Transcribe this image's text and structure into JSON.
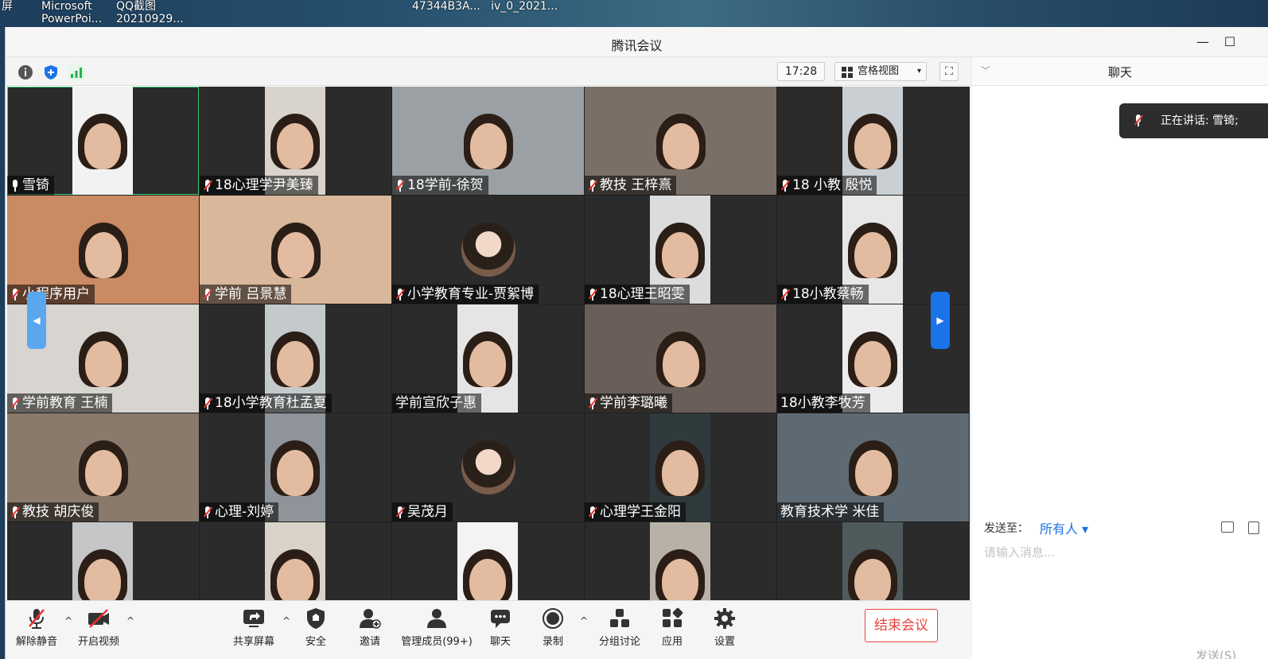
{
  "desktop": {
    "labels": [
      {
        "text": "屏"
      },
      {
        "text": "Microsoft\nPowerPoi..."
      },
      {
        "text": "QQ截图\n20210929..."
      },
      {
        "text": "47344B3A...   iv_0_2021..."
      }
    ]
  },
  "window": {
    "title": "腾讯会议",
    "minimize": "—",
    "maximize": "☐"
  },
  "toolbar": {
    "time": "17:28",
    "view_mode": "宫格视图",
    "caret": "▾",
    "fullscreen": "⛶"
  },
  "participants": [
    {
      "name": "雪锜",
      "muted": false,
      "active": true
    },
    {
      "name": "18心理学尹美臻",
      "muted": true
    },
    {
      "name": "18学前-徐贺",
      "muted": true
    },
    {
      "name": "教技 王梓熹",
      "muted": true
    },
    {
      "name": "18 小教 殷悦",
      "muted": true
    },
    {
      "name": "小程序用户",
      "muted": true
    },
    {
      "name": "学前 吕景慧",
      "muted": true
    },
    {
      "name": "小学教育专业-贾絮博",
      "muted": true
    },
    {
      "name": "18心理王昭雯",
      "muted": true
    },
    {
      "name": "18小教蔡畅",
      "muted": true
    },
    {
      "name": "学前教育 王楠",
      "muted": true
    },
    {
      "name": "18小学教育杜孟夏",
      "muted": true
    },
    {
      "name": "学前宣欣子惠",
      "muted": false,
      "no_mic": true
    },
    {
      "name": "学前李璐曦",
      "muted": true
    },
    {
      "name": "18小教李牧芳",
      "muted": false,
      "no_mic": true
    },
    {
      "name": "教技 胡庆俊",
      "muted": true
    },
    {
      "name": "心理-刘婷",
      "muted": true
    },
    {
      "name": "吴茂月",
      "muted": true
    },
    {
      "name": "心理学王金阳",
      "muted": true
    },
    {
      "name": "教育技术学 米佳",
      "muted": false,
      "no_mic": true
    },
    {
      "name": "",
      "muted": false
    },
    {
      "name": "",
      "muted": false
    },
    {
      "name": "",
      "muted": false
    },
    {
      "name": "",
      "muted": false
    },
    {
      "name": "",
      "muted": false
    }
  ],
  "pager": {
    "prev": "◀",
    "next": "▶"
  },
  "controls": {
    "unmute": "解除静音",
    "start_video": "开启视频",
    "share_screen": "共享屏幕",
    "security": "安全",
    "invite": "邀请",
    "manage_members": "管理成员(99+)",
    "chat": "聊天",
    "record": "录制",
    "breakout": "分组讨论",
    "apps": "应用",
    "settings": "设置",
    "end_meeting": "结束会议",
    "caret_up": "^"
  },
  "chat": {
    "title": "聊天",
    "collapse": "﹀",
    "speaking": "正在讲话: 雪锜;",
    "send_to_label": "发送至：",
    "send_to_value": "所有人 ▾",
    "input_placeholder": "请输入消息...",
    "send_button": "发送(S)"
  },
  "colors": {
    "accent_blue": "#1a73e8",
    "end_red": "#e5443d",
    "active_green": "#3bd27a",
    "muted_red": "#e33333"
  }
}
